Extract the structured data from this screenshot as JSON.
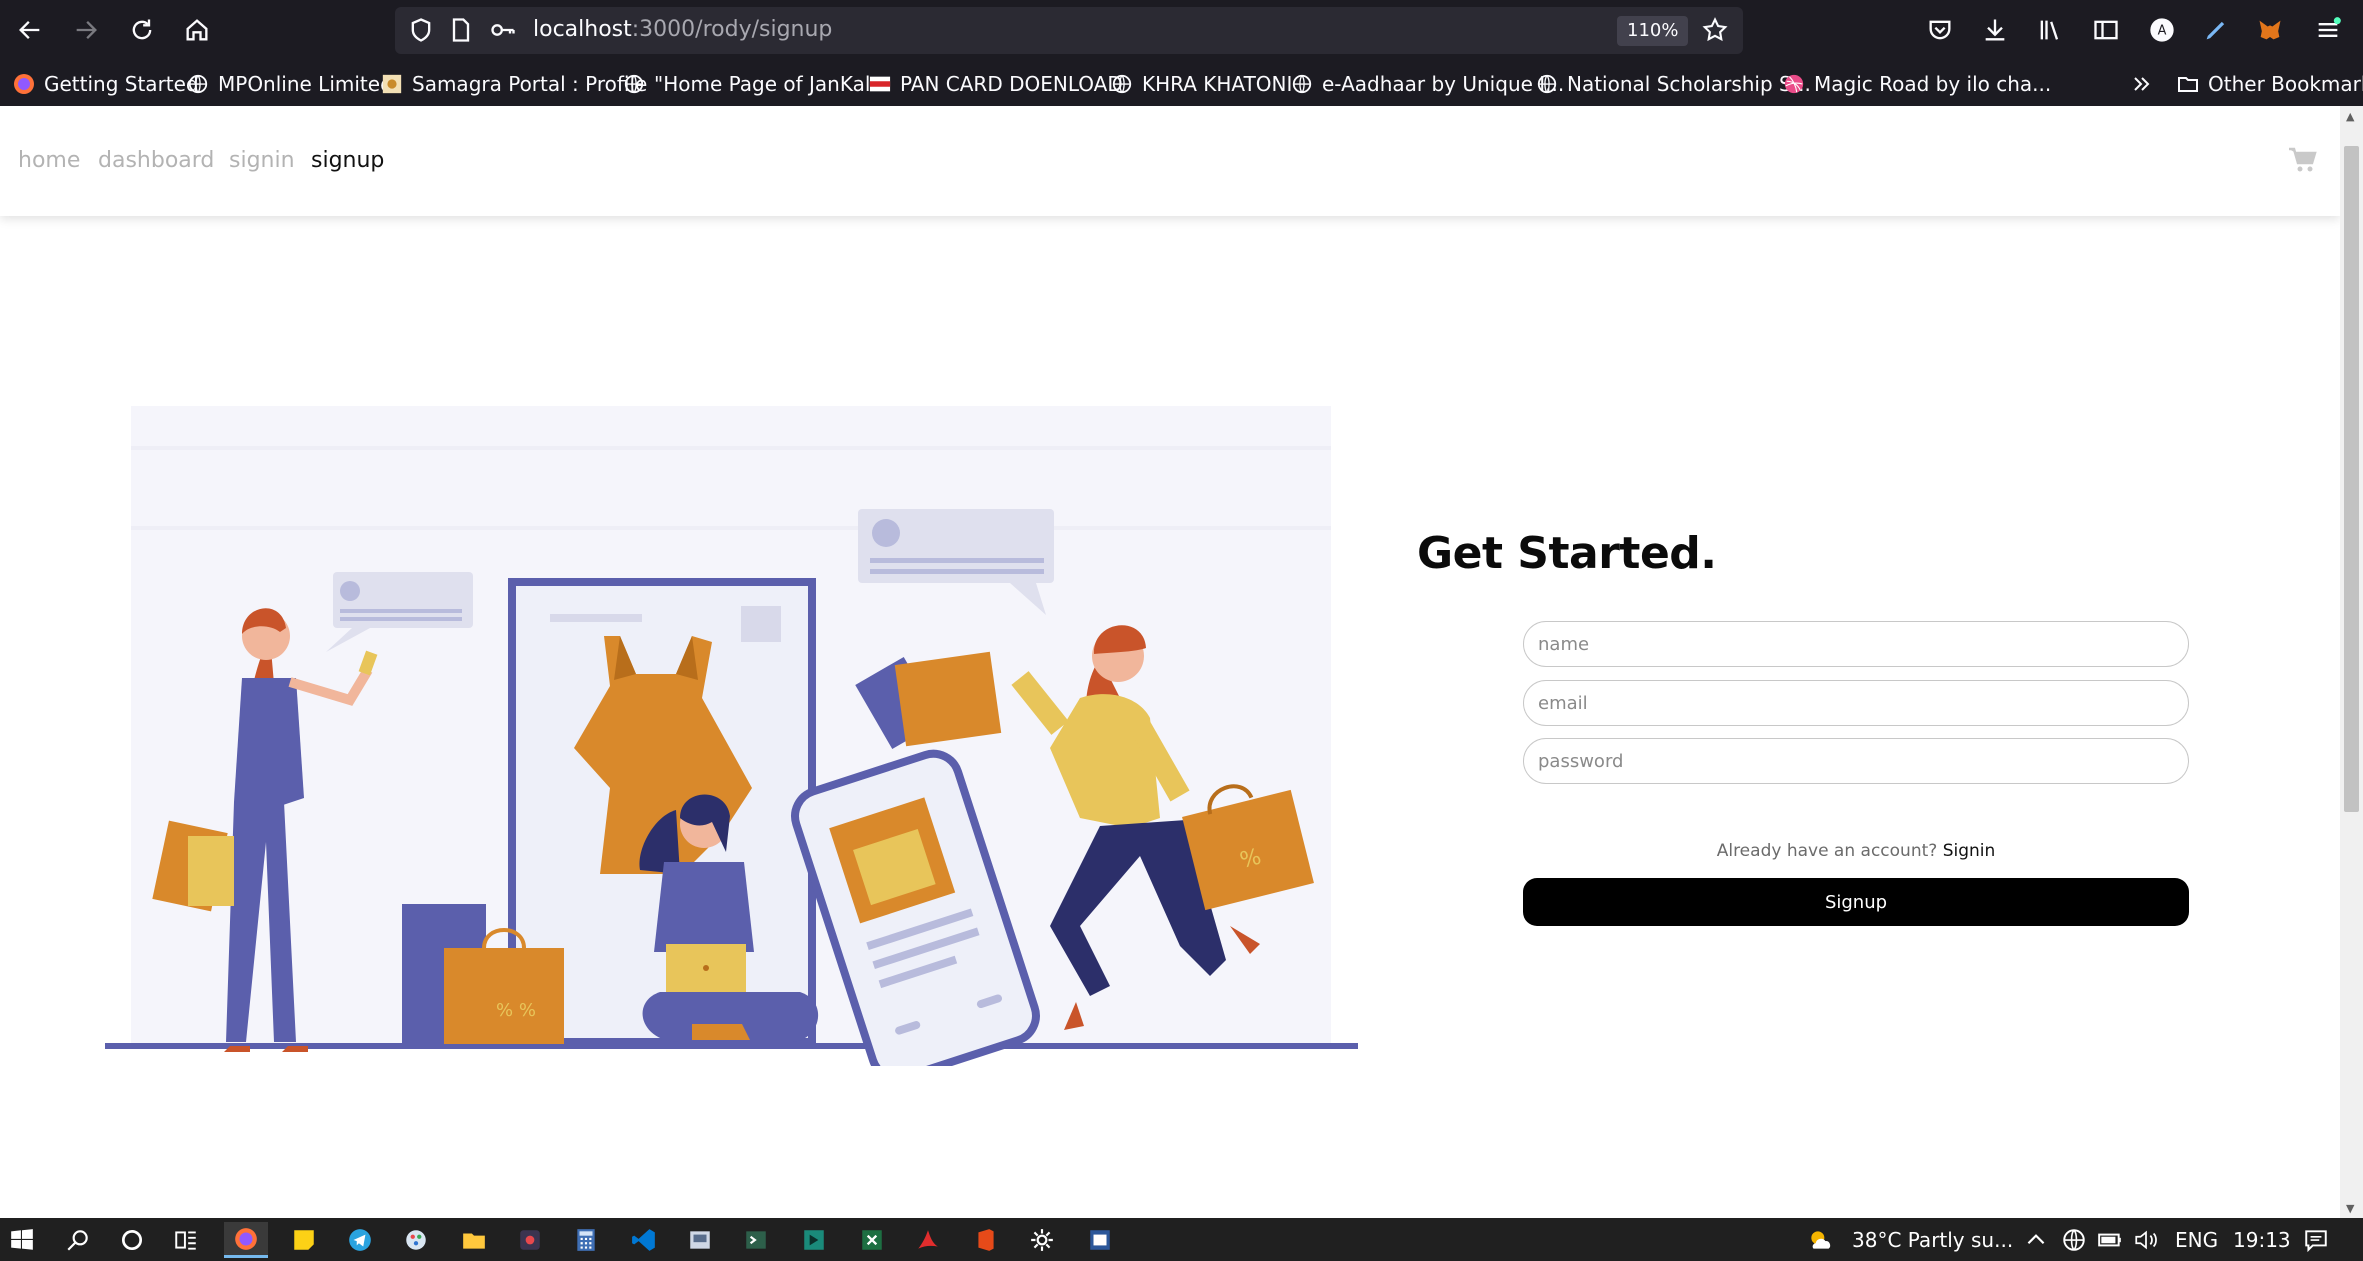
{
  "browser": {
    "url_host": "localhost",
    "url_path": ":3000/rody/signup",
    "zoom": "110%",
    "bookmarks": [
      {
        "label": "Getting Started",
        "icon": "firefox-icon"
      },
      {
        "label": "MPOnline Limited",
        "icon": "globe-icon"
      },
      {
        "label": "Samagra Portal : Profile",
        "icon": "samagra-icon"
      },
      {
        "label": "\"Home Page of JanKal...",
        "icon": "globe-icon"
      },
      {
        "label": "PAN CARD DOENLOAD",
        "icon": "nsdl-icon"
      },
      {
        "label": "KHRA KHATONI",
        "icon": "globe-icon"
      },
      {
        "label": "e-Aadhaar by Unique I...",
        "icon": "globe-icon"
      },
      {
        "label": "National Scholarship S...",
        "icon": "globe-icon"
      },
      {
        "label": "Magic Road by ilo cha...",
        "icon": "dribbble-icon"
      }
    ],
    "other_bookmarks": "Other Bookmarks"
  },
  "nav": {
    "links": [
      {
        "label": "home",
        "active": false
      },
      {
        "label": "dashboard",
        "active": false
      },
      {
        "label": "signin",
        "active": false
      },
      {
        "label": "signup",
        "active": true
      }
    ]
  },
  "form": {
    "title": "Get Started.",
    "name_placeholder": "name",
    "email_placeholder": "email",
    "password_placeholder": "password",
    "signin_prompt": "Already have an account?",
    "signin_link": "Signin",
    "submit_label": "Signup"
  },
  "taskbar": {
    "weather": "38°C  Partly su...",
    "language": "ENG",
    "time": "19:13"
  },
  "colors": {
    "accent_purple": "#5b5fac",
    "accent_orange": "#d9892b",
    "accent_yellow": "#e8c55a",
    "button_black": "#000000"
  }
}
